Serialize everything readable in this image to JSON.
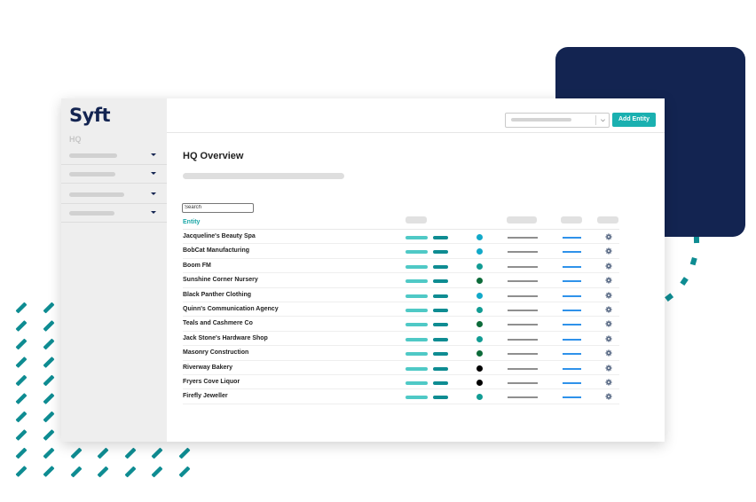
{
  "colors": {
    "navy": "#132451",
    "teal": "#1ab0b0",
    "teal_light": "#4fc9c6",
    "teal_dark": "#0e8c92",
    "status_cyan": "#12a9c9",
    "status_teal": "#129c94",
    "status_green": "#0d6b3a",
    "status_black": "#000000"
  },
  "brand": {
    "logo_text": "Syft",
    "logo_icon": "syft-logo"
  },
  "sidebar": {
    "section_label": "HQ",
    "items": [
      {
        "icon": "chevron-down-icon"
      },
      {
        "icon": "chevron-down-icon"
      },
      {
        "icon": "chevron-down-icon"
      },
      {
        "icon": "chevron-down-icon"
      }
    ]
  },
  "header": {
    "select_icon": "chevron-down-icon",
    "add_button_label": "Add Entity"
  },
  "main": {
    "title": "HQ Overview",
    "search_placeholder": "Search",
    "table": {
      "entity_header": "Entity",
      "settings_icon": "gear-icon",
      "rows": [
        {
          "name": "Jacqueline's Beauty Spa",
          "status": "status_cyan"
        },
        {
          "name": "BobCat Manufacturing",
          "status": "status_cyan"
        },
        {
          "name": "Boom FM",
          "status": "status_teal"
        },
        {
          "name": "Sunshine Corner Nursery",
          "status": "status_green"
        },
        {
          "name": "Black Panther Clothing",
          "status": "status_cyan"
        },
        {
          "name": "Quinn's Communication Agency",
          "status": "status_teal"
        },
        {
          "name": "Teals and Cashmere Co",
          "status": "status_green"
        },
        {
          "name": "Jack Stone's Hardware Shop",
          "status": "status_teal"
        },
        {
          "name": "Masonry Construction",
          "status": "status_green"
        },
        {
          "name": "Riverway Bakery",
          "status": "status_black"
        },
        {
          "name": "Fryers Cove Liquor",
          "status": "status_black"
        },
        {
          "name": "Firefly Jeweller",
          "status": "status_teal"
        }
      ]
    }
  }
}
